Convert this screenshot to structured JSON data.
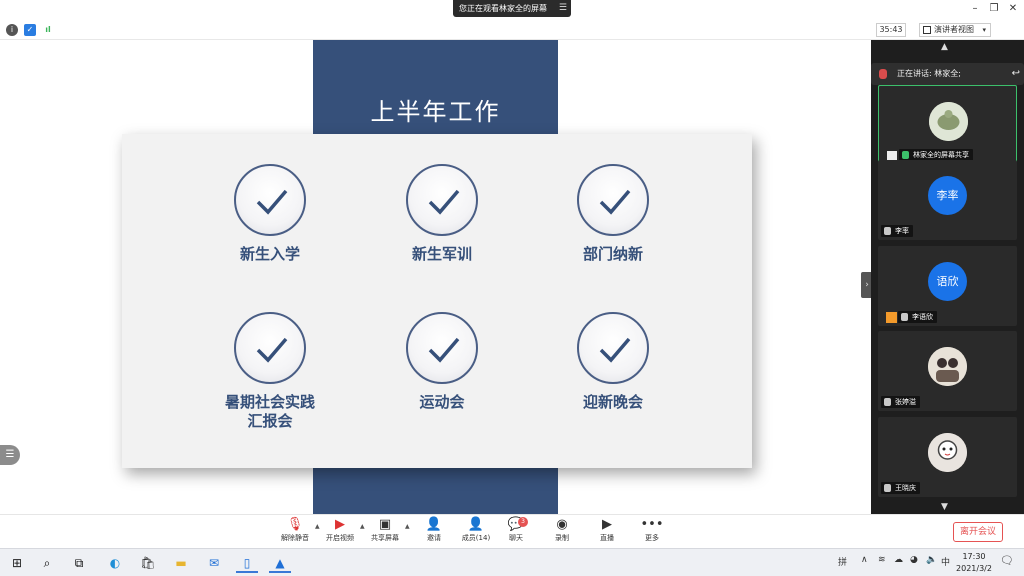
{
  "topbar": {
    "viewing_text": "您正在观看林家全的屏幕",
    "menu_icon": "menu-icon",
    "window_controls": [
      "minimize-icon",
      "restore-icon",
      "close-icon"
    ]
  },
  "info": {
    "indicators": [
      "info-icon",
      "shield-icon",
      "signal-icon"
    ],
    "timer": "35:43",
    "view_label": "演讲者视图"
  },
  "slide": {
    "title": "上半年工作",
    "items": [
      "新生入学",
      "新生军训",
      "部门纳新",
      "暑期社会实践汇报会",
      "运动会",
      "迎新晚会"
    ],
    "item_line2": {
      "3": [
        "暑期社会实践",
        "汇报会"
      ]
    },
    "band_color": "#36507a"
  },
  "panel": {
    "speaking": "正在讲话: 林家全;",
    "tiles": [
      {
        "name": "林家全的屏幕共享",
        "type": "photo"
      },
      {
        "name": "李率",
        "avatar_text": "李率",
        "type": "initial"
      },
      {
        "name": "李语欣",
        "avatar_text": "语欣",
        "type": "initial"
      },
      {
        "name": "张婷溢",
        "type": "photo"
      },
      {
        "name": "王晓庆",
        "type": "photo"
      }
    ],
    "avatar_color": "#1a73e8"
  },
  "toolbar": {
    "buttons": [
      "解除静音",
      "开启视频",
      "共享屏幕",
      "邀请",
      "成员(14)",
      "聊天",
      "录制",
      "直播",
      "更多"
    ],
    "chat_badge": "3",
    "leave": "离开会议"
  },
  "taskbar": {
    "time": "17:30",
    "date": "2021/3/2",
    "input_method": "拼",
    "icons": [
      "windows-icon",
      "search-icon",
      "taskview-icon",
      "edge-icon",
      "store-icon",
      "folder-icon",
      "mail-icon",
      "phone-icon",
      "meeting-icon"
    ]
  }
}
